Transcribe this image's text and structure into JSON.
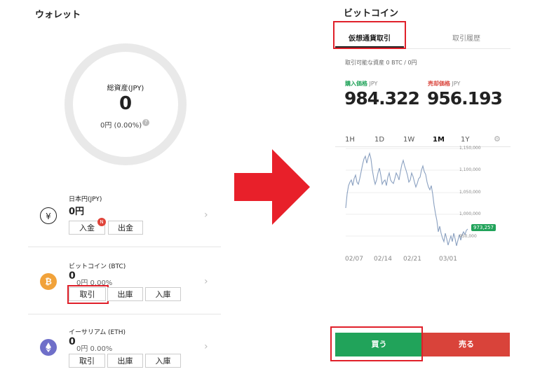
{
  "wallet": {
    "title": "ウォレット",
    "total_label": "総資産(JPY)",
    "total_value": "0",
    "total_sub": "0円 (0.00%)",
    "jpy": {
      "name": "日本円(JPY)",
      "balance": "0円",
      "deposit": "入金",
      "badge": "N",
      "withdraw": "出金"
    },
    "btc": {
      "name": "ビットコイン (BTC)",
      "balance": "0",
      "sub": "0円 0.00%",
      "trade": "取引",
      "send": "出庫",
      "receive": "入庫",
      "icon": "bitcoin-icon"
    },
    "eth": {
      "name": "イーサリアム (ETH)",
      "balance": "0",
      "sub": "0円 0.00%",
      "trade": "取引",
      "send": "出庫",
      "receive": "入庫",
      "icon": "ethereum-icon"
    }
  },
  "trade": {
    "title": "ビットコイン",
    "tab_active": "仮想通貨取引",
    "tab_history": "取引履歴",
    "available": "取引可能な資産 0 BTC / 0円",
    "buy_label": "購入価格",
    "sell_label": "売却価格",
    "currency": "JPY",
    "buy_price": "984.322",
    "sell_price": "956.193",
    "ranges": [
      "1H",
      "1D",
      "1W",
      "1M",
      "1Y"
    ],
    "active_range": "1M",
    "y_labels": [
      "1,150,000",
      "1,100,000",
      "1,050,000",
      "1,000,000",
      "950,000"
    ],
    "x_labels": [
      "02/07",
      "02/14",
      "02/21",
      "03/01"
    ],
    "current_tag": "973,257",
    "buy_button": "買う",
    "sell_button": "売る"
  },
  "colors": {
    "buy": "#21a35a",
    "sell": "#d9433a",
    "arrow": "#e8202a",
    "highlight": "#e0202a",
    "btc": "#f1a23a",
    "eth": "#6f6fc9"
  }
}
